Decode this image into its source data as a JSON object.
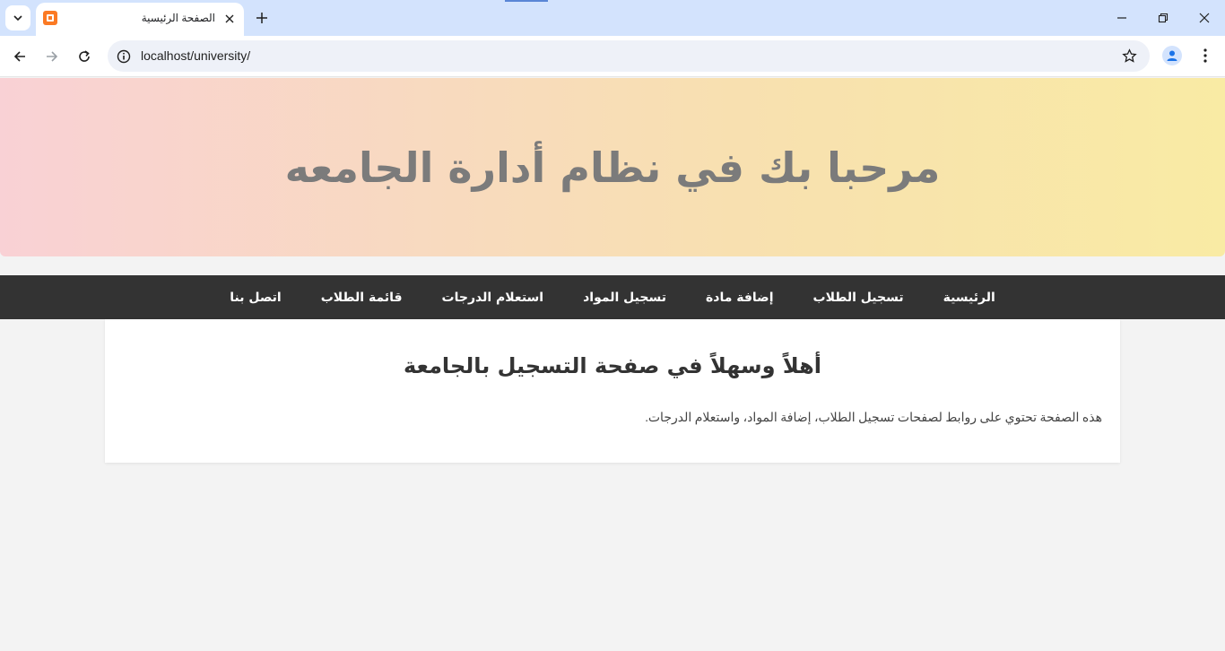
{
  "browser": {
    "tab_title": "الصفحة الرئيسية",
    "url": "localhost/university/"
  },
  "page": {
    "hero_title": "مرحبا بك في نظام أدارة الجامعه",
    "nav": [
      {
        "label": "الرئيسية"
      },
      {
        "label": "تسجيل الطلاب"
      },
      {
        "label": "إضافة مادة"
      },
      {
        "label": "تسجيل المواد"
      },
      {
        "label": "استعلام الدرجات"
      },
      {
        "label": "قائمة الطلاب"
      },
      {
        "label": "اتصل بنا"
      }
    ],
    "welcome_heading": "أهلاً وسهلاً في صفحة التسجيل بالجامعة",
    "welcome_text": "هذه الصفحة تحتوي على روابط لصفحات تسجيل الطلاب، إضافة المواد، واستعلام الدرجات."
  },
  "colors": {
    "hero_gradient_start": "#f9d1d5",
    "hero_gradient_end": "#f9eba4",
    "navbar_bg": "#333333",
    "page_bg": "#f3f3f3"
  }
}
